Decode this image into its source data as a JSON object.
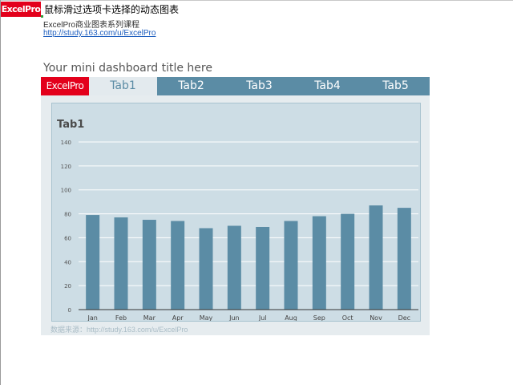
{
  "header": {
    "logo_text": "ExcelPro",
    "title": "鼠标滑过选项卡选择的动态图表",
    "subtitle": "ExcelPro商业图表系列课程",
    "link": "http://study.163.com/u/ExcelPro"
  },
  "dashboard": {
    "title": "Your mini dashboard title here",
    "logo": "ExcelPro",
    "tabs": [
      {
        "label": "Tab1",
        "active": true
      },
      {
        "label": "Tab2",
        "active": false
      },
      {
        "label": "Tab3",
        "active": false
      },
      {
        "label": "Tab4",
        "active": false
      },
      {
        "label": "Tab5",
        "active": false
      }
    ],
    "source": "数据来源：http://study.163.com/u/ExcelPro"
  },
  "colors": {
    "brand_red": "#e3001b",
    "tab_bar": "#5b8ca5",
    "bar": "#5b8ca5",
    "plot_bg": "#cddde5",
    "panel_bg": "#e6ecef"
  },
  "chart_data": {
    "type": "bar",
    "title": "Tab1",
    "categories": [
      "Jan",
      "Feb",
      "Mar",
      "Apr",
      "May",
      "Jun",
      "Jul",
      "Aug",
      "Sep",
      "Oct",
      "Nov",
      "Dec"
    ],
    "values": [
      79,
      77,
      75,
      74,
      68,
      70,
      69,
      74,
      78,
      80,
      87,
      85
    ],
    "ylim": [
      0,
      140
    ],
    "yticks": [
      20,
      40,
      60,
      80,
      100,
      120,
      140
    ],
    "grid": true,
    "xlabel": "",
    "ylabel": ""
  }
}
